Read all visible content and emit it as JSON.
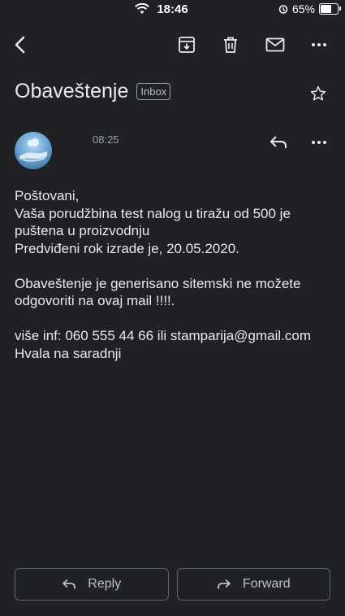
{
  "status_bar": {
    "time": "18:46",
    "battery_percent": "65%",
    "battery_level": 0.65
  },
  "toolbar": {
    "icons": [
      "back-arrow-icon",
      "archive-icon",
      "trash-icon",
      "mail-icon",
      "more-icon"
    ]
  },
  "message": {
    "subject": "Obaveštenje",
    "label": "Inbox",
    "time": "08:25",
    "body": [
      "Poštovani,",
      "Vaša porudžbina test nalog u tiražu od 500 je puštena u proizvodnju",
      "Predviđeni rok izrade je, 20.05.2020.",
      "",
      "Obaveštenje je generisano sitemski ne možete odgovoriti na ovaj mail !!!!.",
      "",
      "više inf: 060 555 44 66 ili stamparija@gmail.com",
      "Hvala na saradnji"
    ]
  },
  "actions": {
    "reply_label": "Reply",
    "forward_label": "Forward"
  },
  "colors": {
    "background": "#202124",
    "text": "#e8eaed",
    "muted": "#9aa0a6",
    "border": "#5f6368"
  }
}
